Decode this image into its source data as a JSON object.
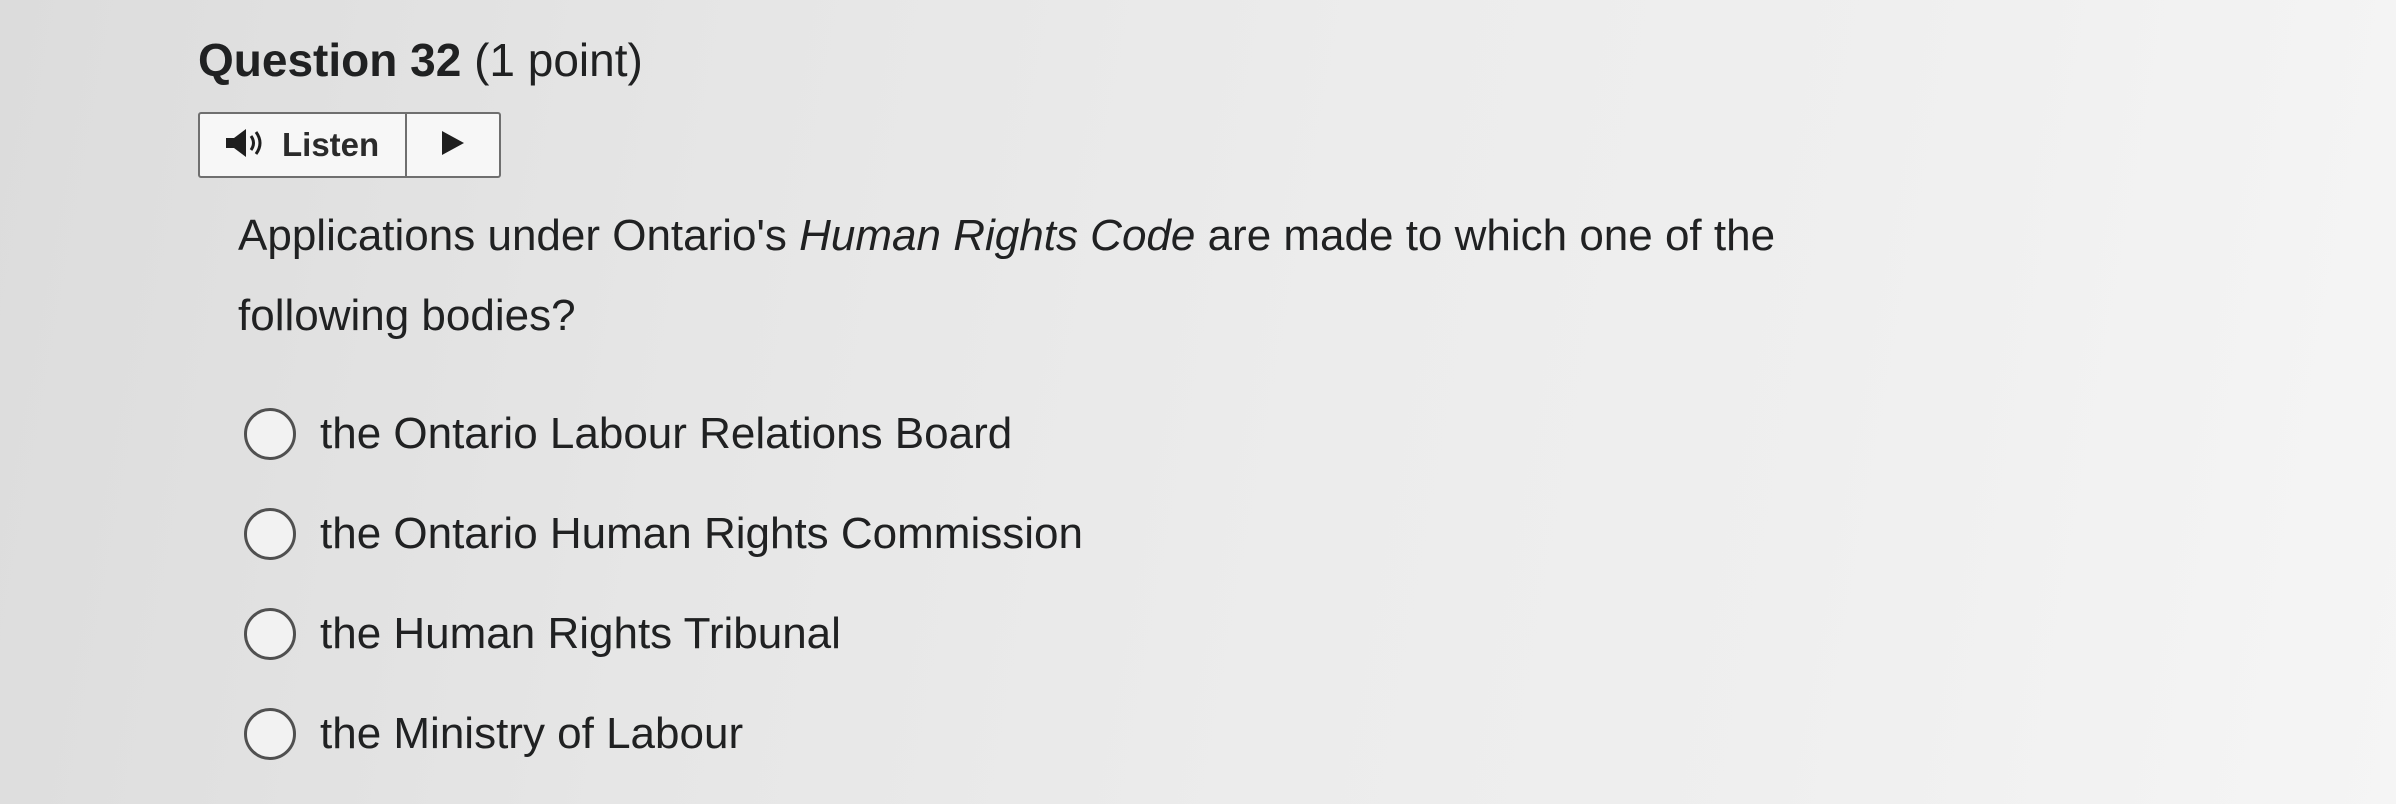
{
  "question": {
    "number_label": "Question 32",
    "points_label": "(1 point)"
  },
  "listen": {
    "label": "Listen",
    "speaker_icon": "speaker-icon",
    "play_icon": "play-icon"
  },
  "prompt": {
    "before": "Applications under Ontario's ",
    "emphasis": "Human Rights Code",
    "after": " are made to which one of the following bodies?"
  },
  "options": [
    {
      "label": "the Ontario Labour Relations Board"
    },
    {
      "label": "the Ontario Human Rights Commission"
    },
    {
      "label": "the Human Rights Tribunal"
    },
    {
      "label": "the Ministry of Labour"
    }
  ]
}
